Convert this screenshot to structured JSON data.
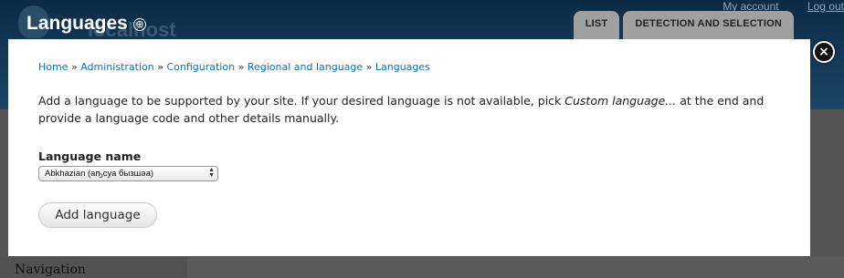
{
  "header": {
    "title": "Languages",
    "shortcut_symbol": "⊕",
    "site_name": "localhost",
    "user_links": [
      "My account",
      "Log out"
    ],
    "tabs": [
      "LIST",
      "DETECTION AND SELECTION"
    ]
  },
  "background": {
    "nav_title": "Navigation"
  },
  "modal": {
    "close_symbol": "×",
    "breadcrumb": [
      "Home",
      "Administration",
      "Configuration",
      "Regional and language",
      "Languages"
    ],
    "breadcrumb_sep": "»",
    "description_start": "Add a language to be supported by your site. If your desired language is not available, pick ",
    "description_em": "Custom language...",
    "description_end": " at the end and provide a language code and other details manually.",
    "field_label": "Language name",
    "select_value": "Abkhazian (аҧсуа бызшәа)",
    "submit_label": "Add language"
  }
}
